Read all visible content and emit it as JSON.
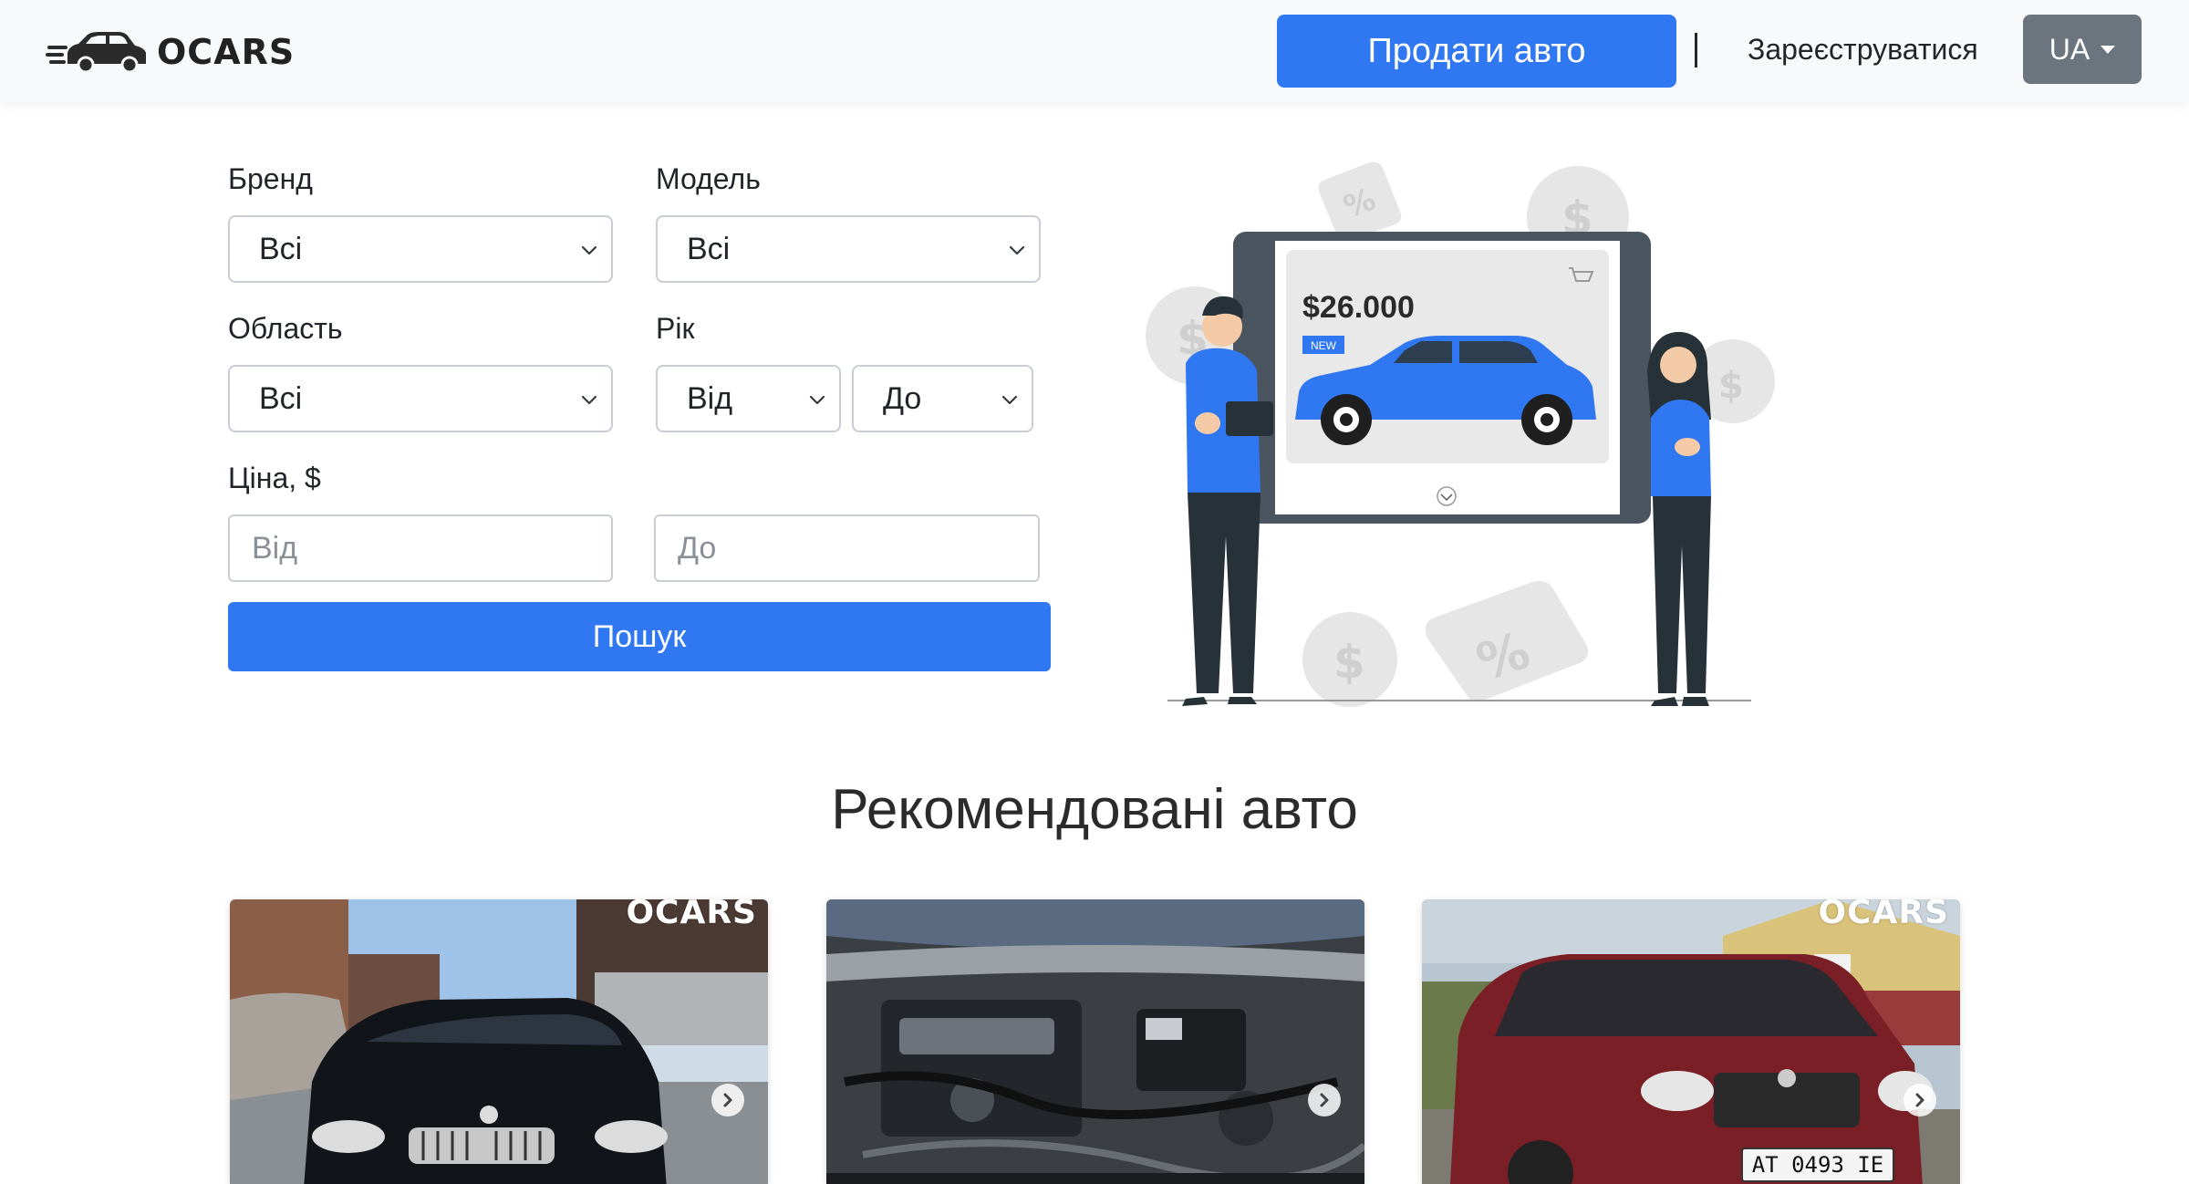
{
  "header": {
    "logo_text": "OCARS",
    "sell_button": "Продати авто",
    "register_link": "Зареєструватися",
    "language": "UA"
  },
  "search": {
    "brand_label": "Бренд",
    "brand_value": "Всі",
    "model_label": "Модель",
    "model_value": "Всі",
    "region_label": "Область",
    "region_value": "Всі",
    "year_label": "Рік",
    "year_from": "Від",
    "year_to": "До",
    "price_label": "Ціна, $",
    "price_from_placeholder": "Від",
    "price_to_placeholder": "До",
    "search_button": "Пошук"
  },
  "illustration": {
    "price": "$26.000",
    "badge": "NEW"
  },
  "featured": {
    "title": "Рекомендовані авто",
    "cards": [
      {
        "watermark": "OCARS",
        "photo": "black BMW front view"
      },
      {
        "watermark": "",
        "photo": "engine bay"
      },
      {
        "watermark": "OCARS",
        "photo": "red Skoda wagon",
        "plate": "AT 0493 IE"
      }
    ]
  },
  "colors": {
    "primary": "#3077f2",
    "secondary": "#6c757d",
    "header_bg": "#f8f9fa"
  }
}
